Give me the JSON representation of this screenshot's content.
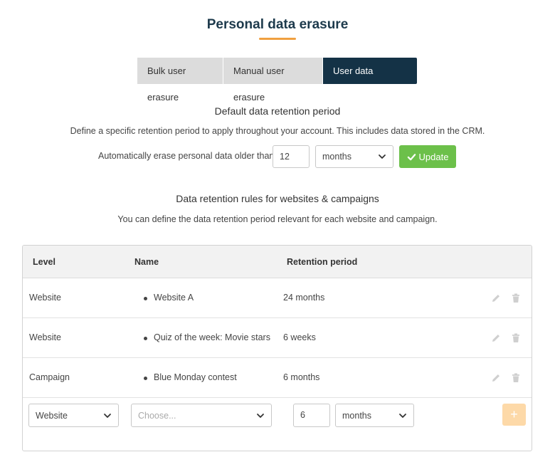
{
  "page": {
    "title": "Personal data erasure"
  },
  "tabs": [
    {
      "label": "Bulk user erasure",
      "active": false
    },
    {
      "label": "Manual user erasure",
      "active": false
    },
    {
      "label": "User data retention",
      "active": true
    }
  ],
  "default_retention": {
    "heading": "Default data retention period",
    "description": "Define a specific retention period to apply throughout your account. This includes data stored in the CRM.",
    "erase_label": "Automatically erase personal data older than",
    "value": "12",
    "unit": "months",
    "update_label": "Update"
  },
  "rules": {
    "heading": "Data retention rules for websites & campaigns",
    "description": "You can define the data retention period relevant for each website and campaign.",
    "headers": {
      "level": "Level",
      "name": "Name",
      "retention": "Retention period"
    },
    "rows": [
      {
        "level": "Website",
        "name": "Website A",
        "retention": "24 months"
      },
      {
        "level": "Website",
        "name": "Quiz of the week: Movie stars",
        "retention": "6 weeks"
      },
      {
        "level": "Campaign",
        "name": "Blue Monday contest",
        "retention": "6 months"
      }
    ],
    "new_rule": {
      "level": "Website",
      "name_placeholder": "Choose...",
      "value": "6",
      "unit": "months",
      "add_label": "+"
    }
  },
  "icons": {
    "edit": "pencil-icon",
    "delete": "trash-icon",
    "check": "check-icon",
    "dropdown": "chevron-down-icon"
  },
  "colors": {
    "primary": "#143246",
    "accent": "#f0a040",
    "success": "#6cc04a",
    "add_button": "#fdd9a8"
  }
}
